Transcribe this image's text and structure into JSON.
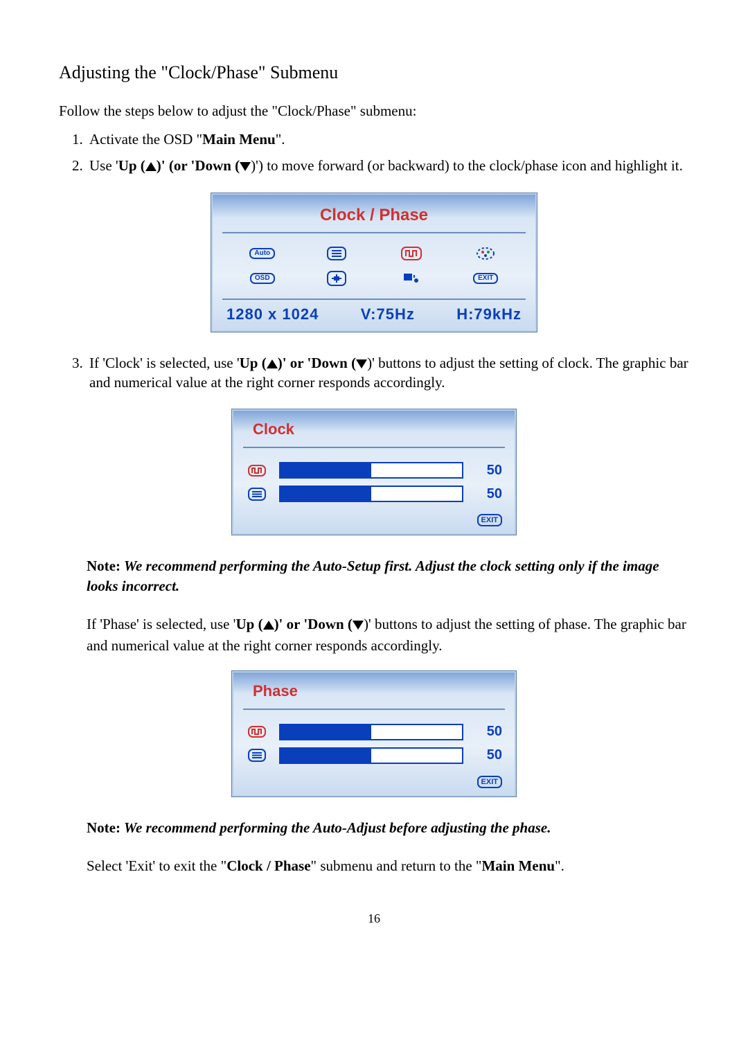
{
  "title": "Adjusting the \"Clock/Phase\" Submenu",
  "intro": "Follow the steps below to adjust the \"Clock/Phase\" submenu:",
  "step1_pre": "Activate the OSD \"",
  "step1_bold": "Main Menu",
  "step1_post": "\".",
  "step2_a": "Use '",
  "step2_up": "Up (",
  "step2_b": ")' (or '",
  "step2_down": "Down (",
  "step2_c": ")') to move forward (or backward) to the clock/phase icon and highlight it.",
  "mainOsd": {
    "title": "Clock / Phase",
    "icons": {
      "auto": "Auto",
      "osd": "OSD",
      "exit": "EXIT"
    },
    "status": {
      "res": "1280 x 1024",
      "v": "V:75Hz",
      "h": "H:79kHz"
    }
  },
  "step3_a": "If 'Clock' is selected, use '",
  "step3_up": "Up (",
  "step3_b": ")' or '",
  "step3_down": "Down (",
  "step3_c": ")' buttons to adjust the setting of clock. The graphic bar and numerical value at the right corner responds accordingly.",
  "clockOsd": {
    "title": "Clock",
    "val1": "50",
    "val2": "50",
    "exit": "EXIT"
  },
  "note1_label": "Note:",
  "note1_body": " We recommend performing the Auto-Setup first. Adjust the clock setting only if the image looks incorrect.",
  "phase_a": "If 'Phase' is selected, use '",
  "phase_up": "Up (",
  "phase_b": ")' or '",
  "phase_down": "Down (",
  "phase_c": ")' buttons to adjust the setting of phase. The graphic bar and numerical value at the right corner responds accordingly.",
  "phaseOsd": {
    "title": "Phase",
    "val1": "50",
    "val2": "50",
    "exit": "EXIT"
  },
  "note2_label": "Note:",
  "note2_body": " We recommend performing the Auto-Adjust before adjusting the phase.",
  "final_a": "Select 'Exit' to exit the \"",
  "final_b": "Clock / Phase",
  "final_c": "\" submenu and return to the \"",
  "final_d": "Main Menu",
  "final_e": "\".",
  "pageNumber": "16"
}
